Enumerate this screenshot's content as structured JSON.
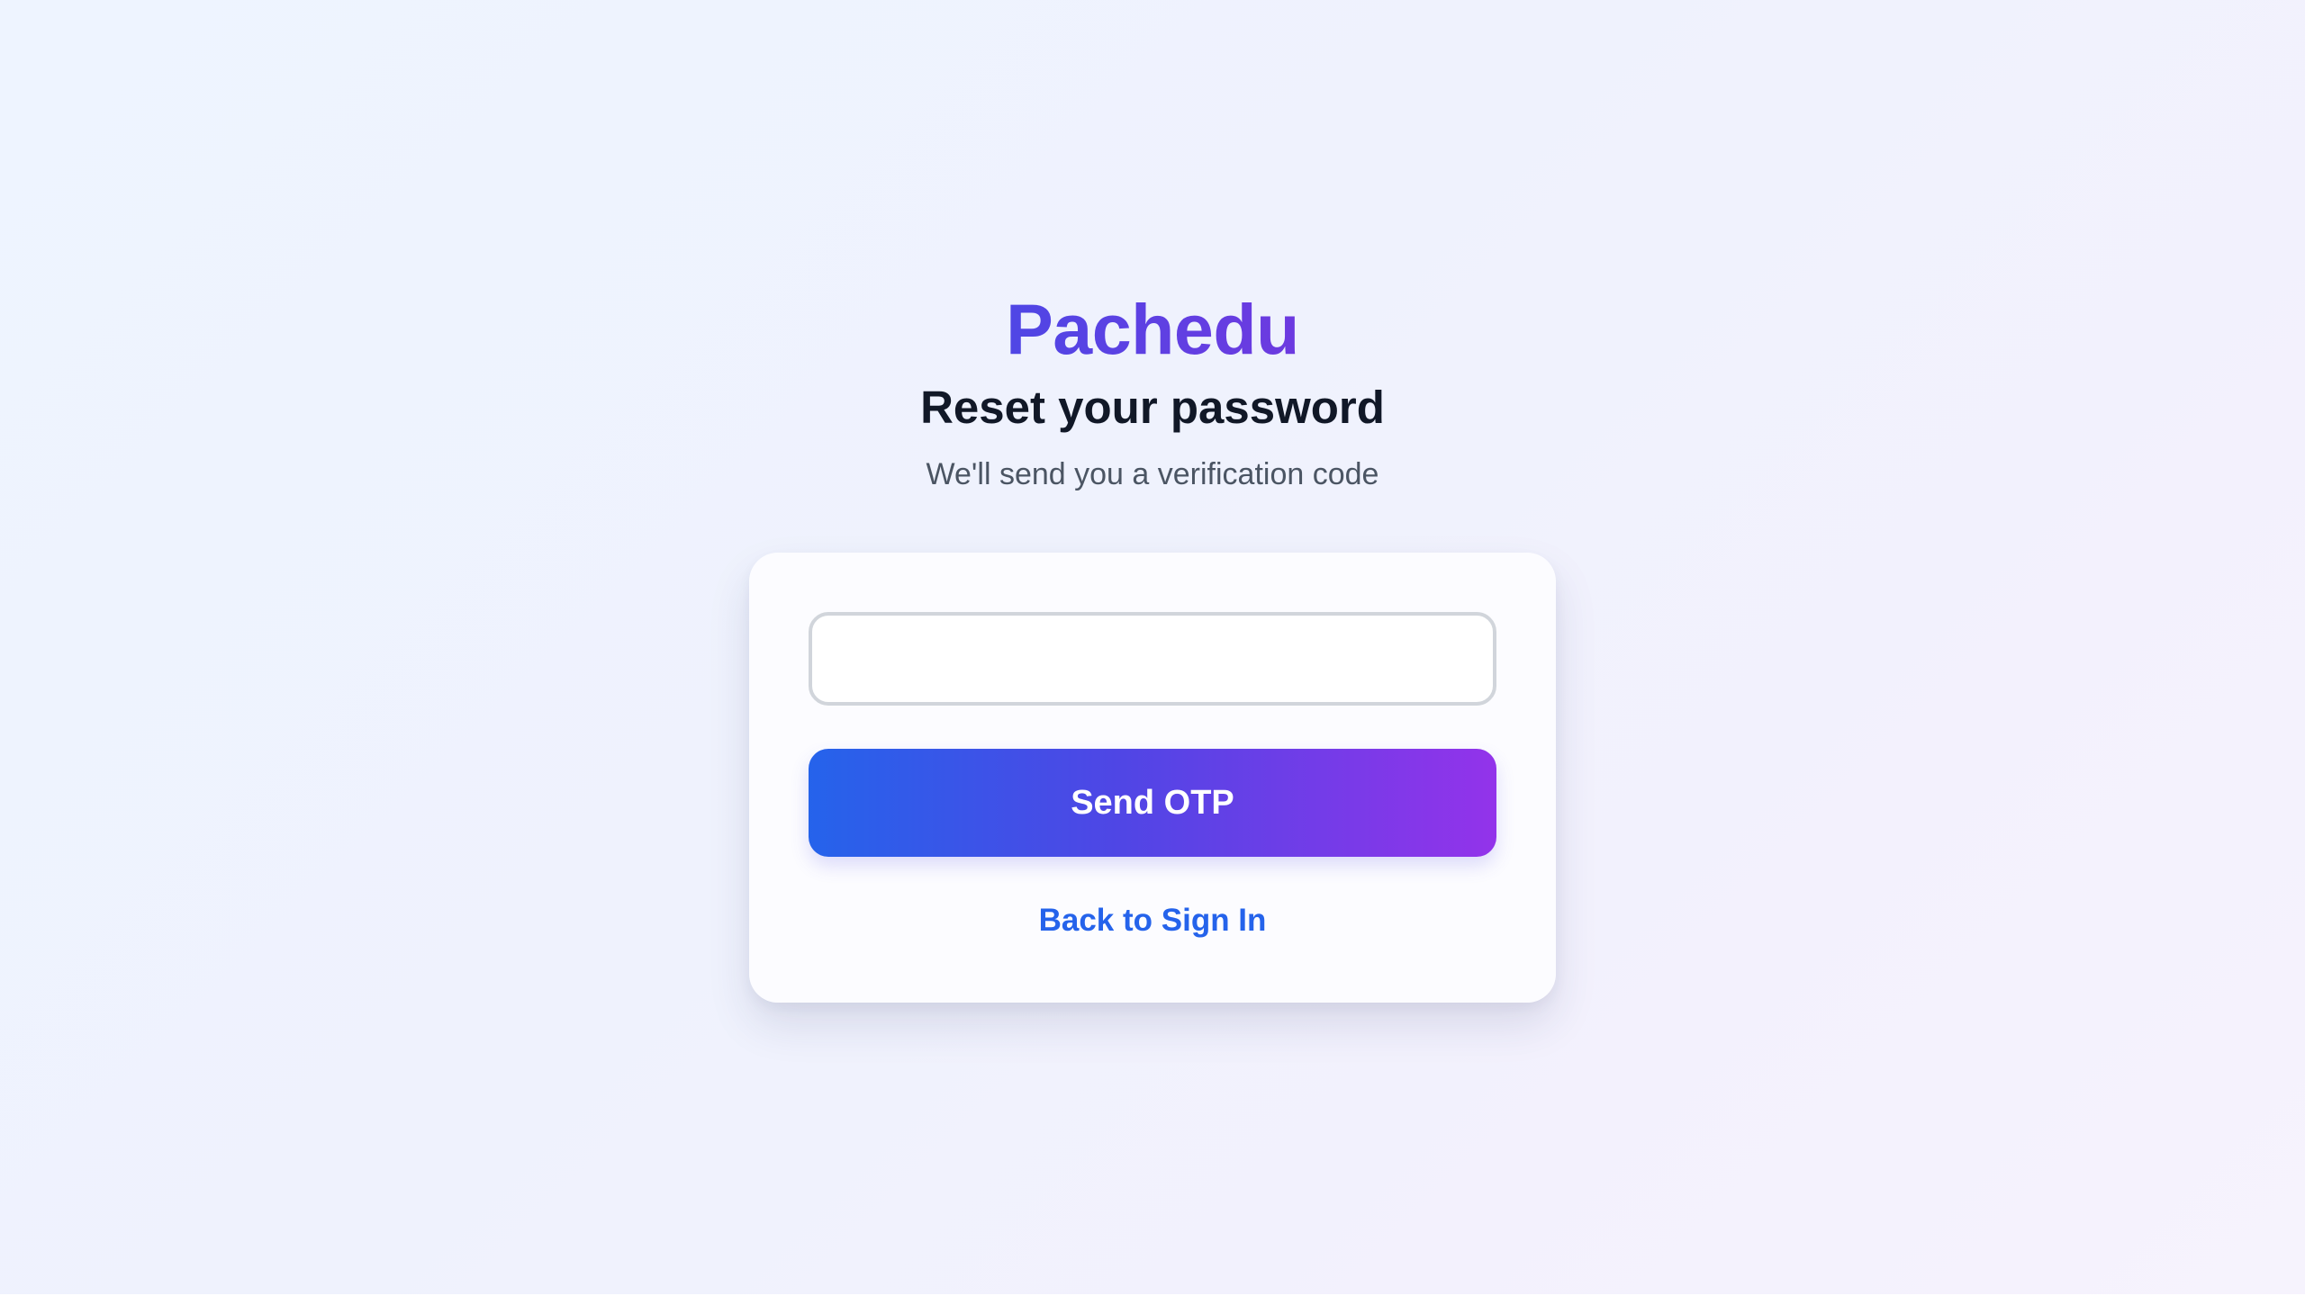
{
  "brand": {
    "name": "Pachedu"
  },
  "header": {
    "title": "Reset your password",
    "subtitle": "We'll send you a verification code"
  },
  "form": {
    "email_value": "",
    "email_placeholder": "",
    "submit_label": "Send OTP",
    "back_link_label": "Back to Sign In"
  },
  "colors": {
    "brand_gradient_start": "#4f46e5",
    "brand_gradient_end": "#6d3ae0",
    "button_gradient_start": "#2563eb",
    "button_gradient_end": "#9333ea",
    "link": "#2563eb",
    "title": "#111827",
    "subtitle": "#4b5563"
  }
}
